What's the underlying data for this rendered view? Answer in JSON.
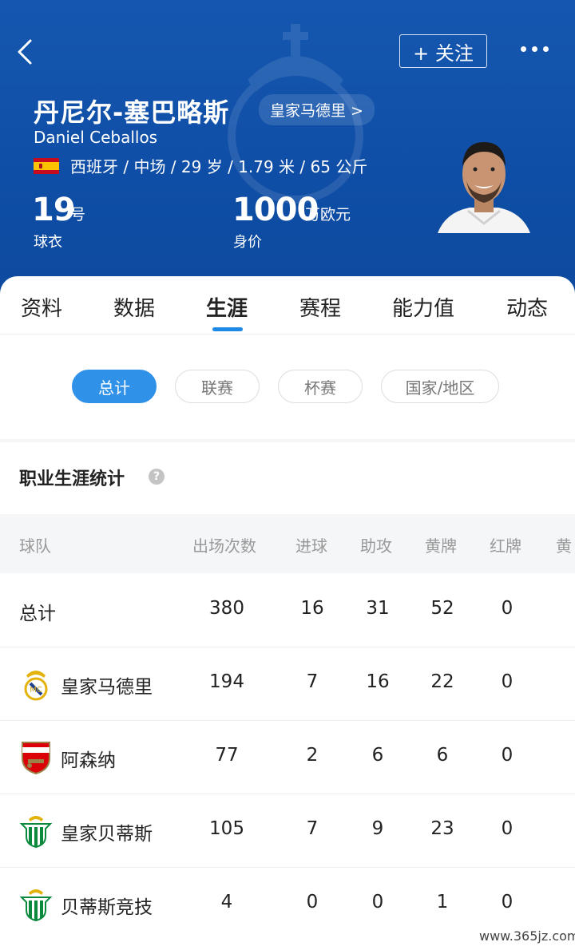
{
  "header": {
    "follow_label": "+ 关注",
    "name_zh": "丹尼尔-塞巴略斯",
    "club_link": "皇家马德里 >",
    "name_en": "Daniel Ceballos",
    "info": "西班牙 / 中场 / 29 岁 / 1.79 米 / 65 公斤",
    "number": "19",
    "number_unit": "号",
    "number_label": "球衣",
    "value": "1000",
    "value_unit": "万欧元",
    "value_label": "身价",
    "bg_color": "#1557b0"
  },
  "tabs": [
    "资料",
    "数据",
    "生涯",
    "赛程",
    "能力值",
    "动态"
  ],
  "active_tab": "生涯",
  "filters": [
    "总计",
    "联赛",
    "杯赛",
    "国家/地区"
  ],
  "active_filter": "总计",
  "section_title": "职业生涯统计",
  "help_icon": "?",
  "table": {
    "headers": [
      "球队",
      "出场次数",
      "进球",
      "助攻",
      "黄牌",
      "红牌",
      "黄"
    ],
    "rows": [
      {
        "team": "总计",
        "apps": "380",
        "goals": "16",
        "assists": "31",
        "yellow": "52",
        "red": "0",
        "logo": ""
      },
      {
        "team": "皇家马德里",
        "apps": "194",
        "goals": "7",
        "assists": "16",
        "yellow": "22",
        "red": "0",
        "logo": "real-madrid-crest-icon"
      },
      {
        "team": "阿森纳",
        "apps": "77",
        "goals": "2",
        "assists": "6",
        "yellow": "6",
        "red": "0",
        "logo": "arsenal-crest-icon"
      },
      {
        "team": "皇家贝蒂斯",
        "apps": "105",
        "goals": "7",
        "assists": "9",
        "yellow": "23",
        "red": "0",
        "logo": "real-betis-crest-icon"
      },
      {
        "team": "贝蒂斯竞技",
        "apps": "4",
        "goals": "0",
        "assists": "0",
        "yellow": "1",
        "red": "0",
        "logo": "betis-deportivo-crest-icon"
      }
    ]
  },
  "watermark": "www.365jz.com",
  "accent_color": "#2f92e8"
}
